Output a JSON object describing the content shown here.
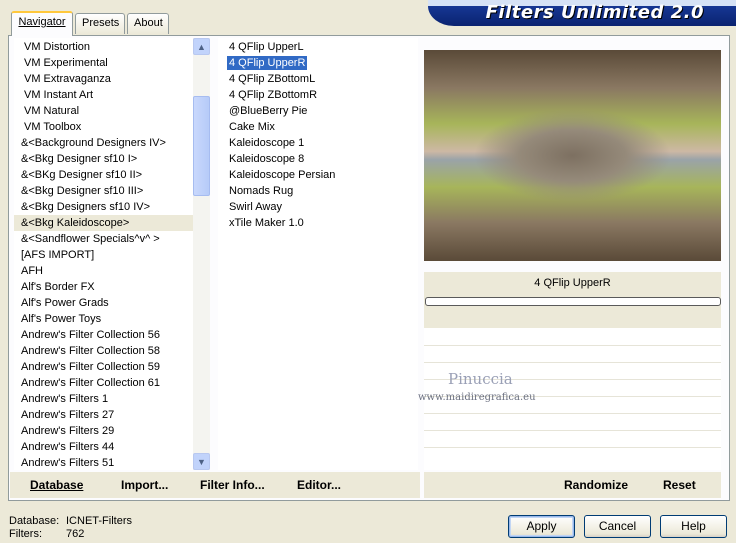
{
  "tabs": [
    {
      "label": "Navigator"
    },
    {
      "label": "Presets"
    },
    {
      "label": "About"
    }
  ],
  "banner": {
    "title": "Filters Unlimited 2.0"
  },
  "categories": [
    "VM Distortion",
    "VM Experimental",
    "VM Extravaganza",
    "VM Instant Art",
    "VM Natural",
    "VM Toolbox",
    "&<Background Designers IV>",
    "&<Bkg Designer sf10 I>",
    "&<BKg Designer sf10 II>",
    "&<Bkg Designer sf10 III>",
    "&<Bkg Designers sf10 IV>",
    "&<Bkg Kaleidoscope>",
    "&<Sandflower Specials^v^ >",
    "[AFS IMPORT]",
    "AFH",
    "Alf's Border FX",
    "Alf's Power Grads",
    "Alf's Power Toys",
    "Andrew's Filter Collection 56",
    "Andrew's Filter Collection 58",
    "Andrew's Filter Collection 59",
    "Andrew's Filter Collection 61",
    "Andrew's Filters 1",
    "Andrew's Filters 27",
    "Andrew's Filters 29",
    "Andrew's Filters 44",
    "Andrew's Filters 51"
  ],
  "filters": [
    "4 QFlip UpperL",
    "4 QFlip UpperR",
    "4 QFlip ZBottomL",
    "4 QFlip ZBottomR",
    "@BlueBerry Pie",
    "Cake Mix",
    "Kaleidoscope 1",
    "Kaleidoscope 8",
    "Kaleidoscope Persian",
    "Nomads Rug",
    "Swirl Away",
    "xTile Maker 1.0"
  ],
  "preview": {
    "filter_name": "4 QFlip UpperR",
    "progress": 0
  },
  "toolbar": {
    "database": "Database",
    "import": "Import...",
    "filter_info": "Filter Info...",
    "editor": "Editor...",
    "randomize": "Randomize",
    "reset": "Reset"
  },
  "status": {
    "database_label": "Database:",
    "database_value": "ICNET-Filters",
    "filters_label": "Filters:",
    "filters_value": "762"
  },
  "buttons": {
    "apply": "Apply",
    "cancel": "Cancel",
    "help": "Help"
  },
  "watermark": {
    "name": "Pinuccia",
    "url": "www.maidiregrafica.eu"
  },
  "colors": {
    "selection": "#316ac5",
    "banner": "#0a2370",
    "tab_accent": "#ffc83c"
  }
}
